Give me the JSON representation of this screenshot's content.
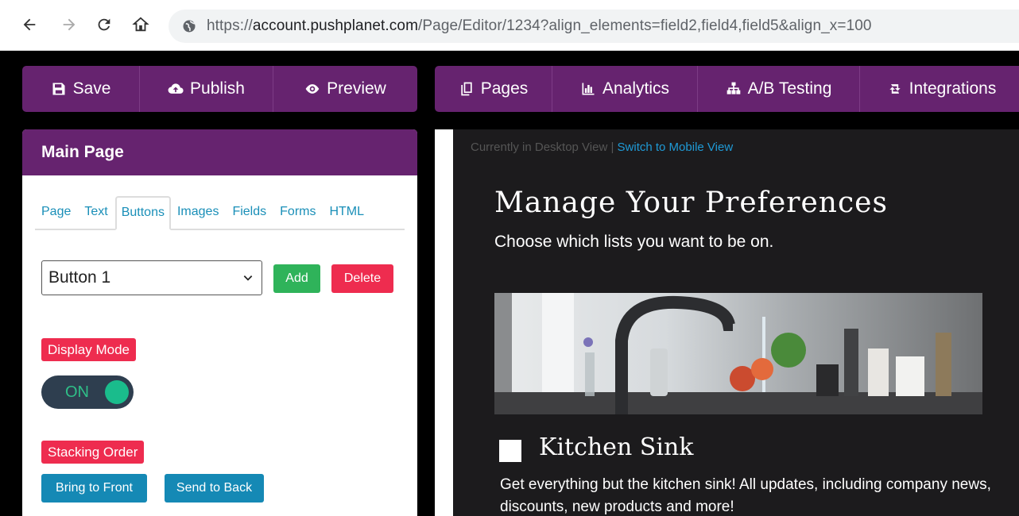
{
  "browser": {
    "url_prefix": "https://",
    "url_host": "account.pushplanet.com",
    "url_path": "/Page/Editor/1234?align_elements=field2,field4,field5&align_x=100"
  },
  "toolbar_left": {
    "save": "Save",
    "publish": "Publish",
    "preview": "Preview"
  },
  "toolbar_right": {
    "pages": "Pages",
    "analytics": "Analytics",
    "ab_testing": "A/B Testing",
    "integrations": "Integrations"
  },
  "panel": {
    "title": "Main Page",
    "tabs": [
      "Page",
      "Text",
      "Buttons",
      "Images",
      "Fields",
      "Forms",
      "HTML"
    ],
    "active_tab": "Buttons",
    "select_value": "Button 1",
    "add_label": "Add",
    "delete_label": "Delete",
    "display_mode_label": "Display Mode",
    "toggle_label": "ON",
    "stacking_label": "Stacking Order",
    "bring_front_label": "Bring to Front",
    "send_back_label": "Send to Back"
  },
  "preview": {
    "view_note": "Currently in Desktop View",
    "separator": " | ",
    "switch_link": "Switch to Mobile View",
    "title": "Manage Your Preferences",
    "subtitle": "Choose which lists you want to be on.",
    "list_title": "Kitchen Sink",
    "list_desc": "Get everything but the kitchen sink! All updates, including company news, discounts, new products and more!"
  },
  "colors": {
    "brand_purple": "#66236f",
    "danger_red": "#ee2c4f",
    "success_green": "#2fb35a",
    "info_blue": "#1589b5"
  }
}
